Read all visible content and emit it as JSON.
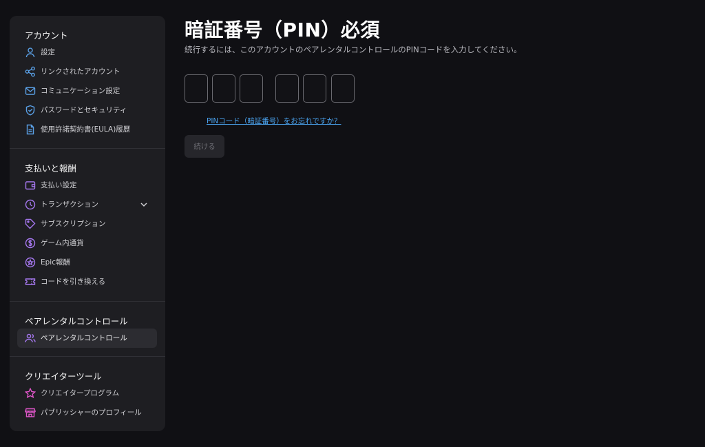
{
  "sidebar": {
    "sections": [
      {
        "title": "アカウント",
        "items": [
          {
            "label": "設定",
            "icon": "person-icon"
          },
          {
            "label": "リンクされたアカウント",
            "icon": "share-nodes-icon"
          },
          {
            "label": "コミュニケーション設定",
            "icon": "envelope-icon"
          },
          {
            "label": "パスワードとセキュリティ",
            "icon": "shield-check-icon"
          },
          {
            "label": "使用許諾契約書(EULA)履歴",
            "icon": "document-icon"
          }
        ]
      },
      {
        "title": "支払いと報酬",
        "items": [
          {
            "label": "支払い設定",
            "icon": "wallet-icon"
          },
          {
            "label": "トランザクション",
            "icon": "clock-icon"
          },
          {
            "label": "サブスクリプション",
            "icon": "tag-icon"
          },
          {
            "label": "ゲーム内通貨",
            "icon": "coin-icon"
          },
          {
            "label": "Epic報酬",
            "icon": "reward-icon"
          },
          {
            "label": "コードを引き換える",
            "icon": "ticket-icon"
          }
        ]
      },
      {
        "title": "ペアレンタルコントロール",
        "items": [
          {
            "label": "ペアレンタルコントロール",
            "icon": "people-icon",
            "active": true
          }
        ]
      },
      {
        "title": "クリエイターツール",
        "items": [
          {
            "label": "クリエイタープログラム",
            "icon": "star-icon"
          },
          {
            "label": "パブリッシャーのプロフィール",
            "icon": "storefront-icon"
          }
        ]
      }
    ]
  },
  "main": {
    "title": "暗証番号（PIN）必須",
    "description": "続行するには、このアカウントのペアレンタルコントロールのPINコードを入力してください。",
    "pin_values": [
      "",
      "",
      "",
      "",
      "",
      ""
    ],
    "forgot_link": "PINコード（暗証番号）をお忘れですか？",
    "continue_label": "続ける"
  },
  "colors": {
    "background": "#101014",
    "sidebar": "#1e1e22",
    "accent_blue": "#5aa0e6",
    "accent_purple": "#a678f0",
    "accent_pink": "#e056c9",
    "link": "#4aa3ef"
  }
}
